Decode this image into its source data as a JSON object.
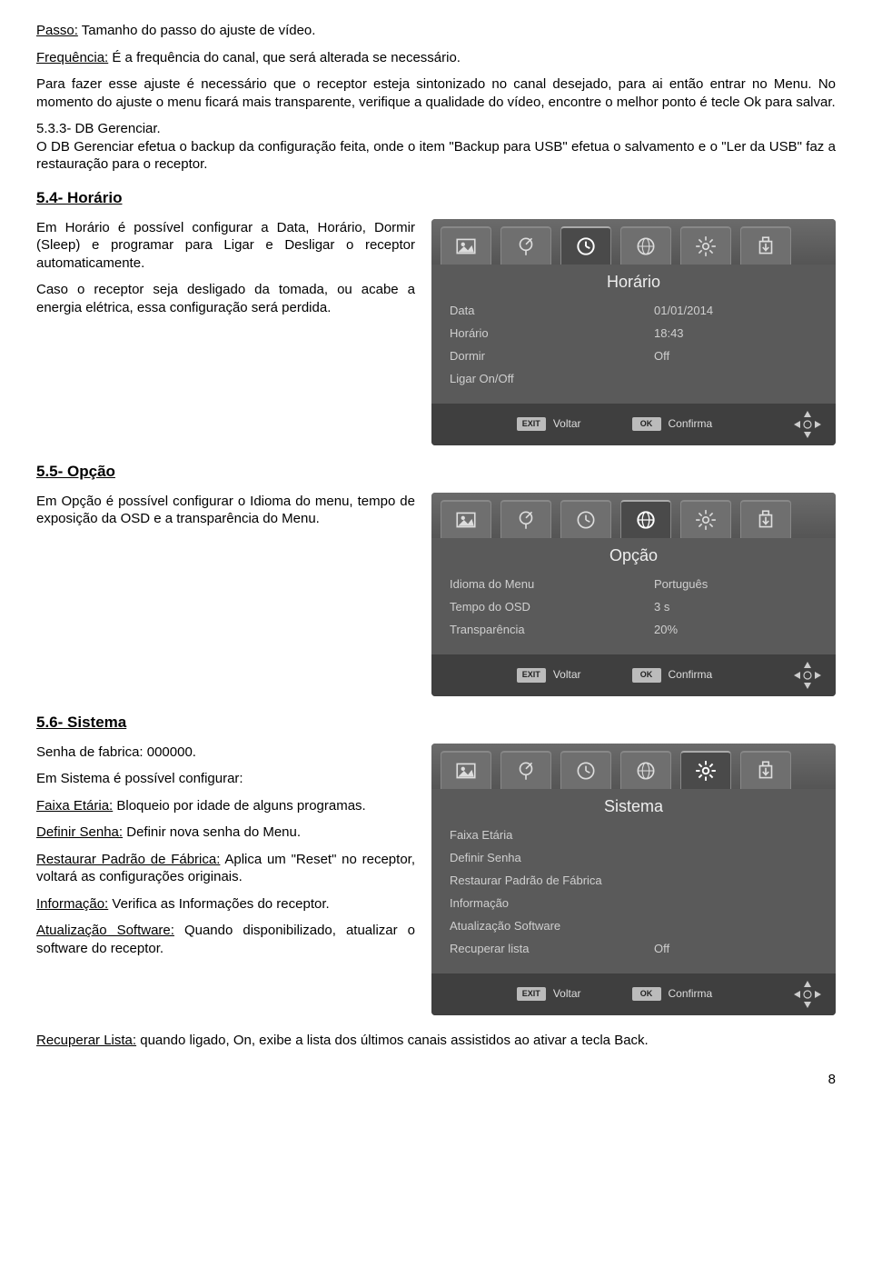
{
  "intro": {
    "passo_lbl": "Passo:",
    "passo_txt": " Tamanho do passo do ajuste de vídeo.",
    "freq_lbl": "Frequência:",
    "freq_txt": " É a frequência do canal, que será alterada se necessário.",
    "para1": "Para fazer esse ajuste é necessário que o receptor esteja sintonizado no canal desejado, para ai então entrar no Menu. No momento do ajuste o menu ficará mais transparente, verifique a qualidade do vídeo, encontre o melhor ponto é tecle Ok para salvar.",
    "sub533": "5.3.3- DB Gerenciar.",
    "sub533_txt": "O DB Gerenciar efetua o backup da configuração feita, onde o item \"Backup para USB\" efetua o salvamento e o \"Ler da USB\" faz a restauração para o receptor."
  },
  "s54": {
    "title": "5.4- Horário",
    "p1": "Em Horário é possível configurar a Data, Horário, Dormir (Sleep) e programar para Ligar e Desligar o receptor automaticamente.",
    "p2": "Caso o receptor seja desligado da tomada, ou acabe a energia elétrica, essa configuração será perdida."
  },
  "s55": {
    "title": "5.5- Opção",
    "p1": "Em Opção é possível configurar o Idioma do menu, tempo de exposição da OSD e a transparência do Menu."
  },
  "s56": {
    "title": "5.6- Sistema",
    "p_senha": "Senha de fabrica: 000000.",
    "p_intro": "Em Sistema é possível configurar:",
    "fe_lbl": "Faixa Etária:",
    "fe_txt": " Bloqueio por idade de alguns programas.",
    "ds_lbl": "Definir Senha:",
    "ds_txt": " Definir nova senha do Menu.",
    "rp_lbl": "Restaurar Padrão de Fábrica:",
    "rp_txt": " Aplica um \"Reset\" no receptor, voltará as configurações originais.",
    "inf_lbl": "Informação:",
    "inf_txt": " Verifica as Informações do receptor.",
    "as_lbl": "Atualização Software:",
    "as_txt": " Quando disponibilizado, atualizar o software do receptor.",
    "rl_lbl": "Recuperar Lista:",
    "rl_txt": " quando ligado, On, exibe a lista dos últimos canais assistidos ao ativar a tecla Back."
  },
  "horario_shot": {
    "title": "Horário",
    "rows": [
      {
        "lbl": "Data",
        "val": "01/01/2014"
      },
      {
        "lbl": "Horário",
        "val": "18:43"
      },
      {
        "lbl": "Dormir",
        "val": "Off"
      },
      {
        "lbl": "Ligar On/Off",
        "val": ""
      }
    ]
  },
  "opcao_shot": {
    "title": "Opção",
    "rows": [
      {
        "lbl": "Idioma do Menu",
        "val": "Português"
      },
      {
        "lbl": "Tempo do OSD",
        "val": "3 s"
      },
      {
        "lbl": "Transparência",
        "val": "20%"
      }
    ]
  },
  "sistema_shot": {
    "title": "Sistema",
    "rows": [
      {
        "lbl": "Faixa Etária",
        "val": ""
      },
      {
        "lbl": "Definir Senha",
        "val": ""
      },
      {
        "lbl": "Restaurar Padrão de Fábrica",
        "val": ""
      },
      {
        "lbl": "Informação",
        "val": ""
      },
      {
        "lbl": "Atualização Software",
        "val": ""
      },
      {
        "lbl": "Recuperar lista",
        "val": "Off"
      }
    ]
  },
  "footer": {
    "exit_key": "EXIT",
    "exit_lbl": "Voltar",
    "ok_key": "OK",
    "ok_lbl": "Confirma"
  },
  "page_num": "8"
}
